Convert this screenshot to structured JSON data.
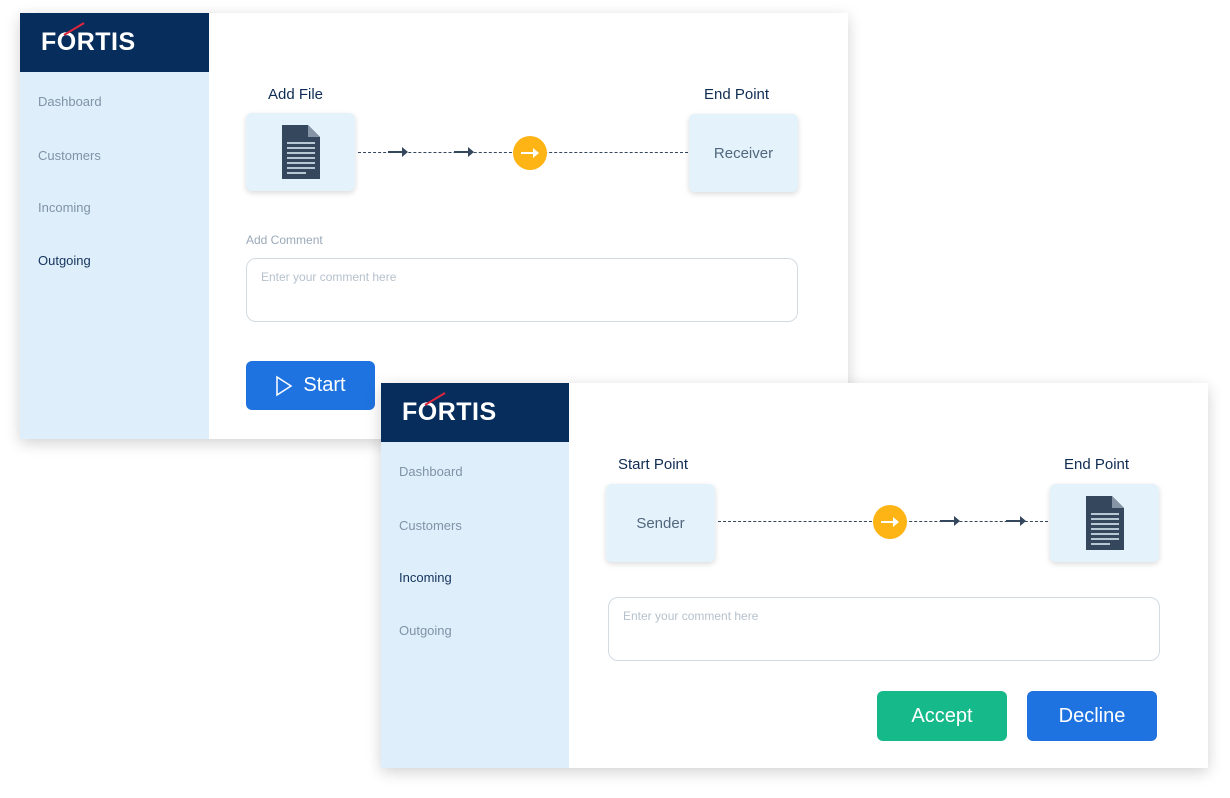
{
  "brand": "FORTIS",
  "nav": [
    "Dashboard",
    "Customers",
    "Incoming",
    "Outgoing"
  ],
  "outgoing": {
    "start_label": "Add File",
    "end_label": "End Point",
    "receiver": "Receiver",
    "comment_label": "Add Comment",
    "comment_placeholder": "Enter your comment here",
    "start_button": "Start",
    "active_nav": "Outgoing"
  },
  "incoming": {
    "start_label": "Start Point",
    "end_label": "End Point",
    "sender": "Sender",
    "comment_placeholder": "Enter your comment here",
    "accept_button": "Accept",
    "decline_button": "Decline",
    "active_nav": "Incoming"
  },
  "colors": {
    "logo_bar": "#062d5c",
    "sidebar": "#dfeefb",
    "accent_blue": "#1e73e0",
    "accent_green": "#16b98a",
    "flow_indicator": "#fdb414"
  },
  "icons": [
    "document-icon",
    "arrow-right-icon",
    "play-icon",
    "logo-swoosh-icon"
  ]
}
